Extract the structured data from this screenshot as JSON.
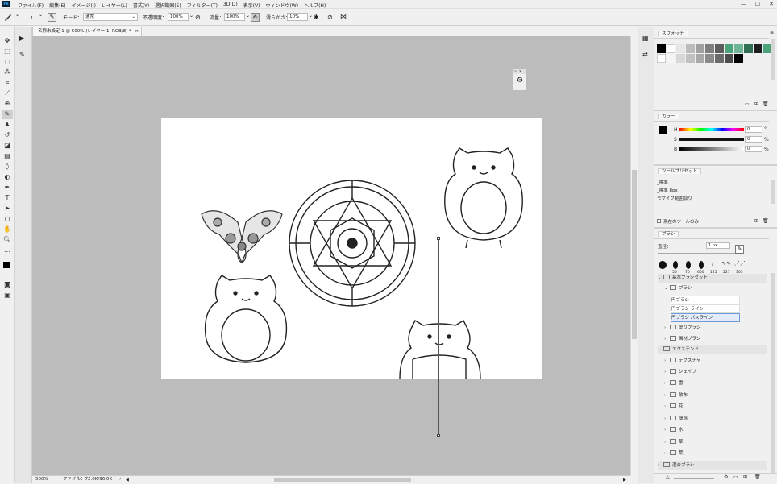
{
  "app": {
    "logo": "Ps"
  },
  "menu": [
    "ファイル(F)",
    "編集(E)",
    "イメージ(I)",
    "レイヤー(L)",
    "書式(Y)",
    "選択範囲(S)",
    "フィルター(T)",
    "3D(D)",
    "表示(V)",
    "ウィンドウ(W)",
    "ヘルプ(H)"
  ],
  "window_controls": {
    "minimize": "—",
    "maximize": "☐",
    "close": "✕"
  },
  "options": {
    "brush_size": "1",
    "mode_label": "モード：",
    "mode_value": "通常",
    "opacity_label": "不透明度：",
    "opacity_value": "100%",
    "flow_label": "流量：",
    "flow_value": "100%",
    "smoothing_label": "滑らかさ：",
    "smoothing_value": "10%"
  },
  "document": {
    "tab_title": "名称未設定 1 @ 500% (レイヤー 1, RGB/8) *",
    "tab_close": "×"
  },
  "status": {
    "zoom": "500%",
    "file_info": "ファイル：72.0K/96.0K"
  },
  "panels": {
    "swatches": {
      "tab": "スウォッチ"
    },
    "color": {
      "tab": "カラー",
      "h_label": "H",
      "s_label": "S",
      "b_label": "B",
      "h_value": "0",
      "s_value": "0",
      "b_value": "0",
      "unit_deg": "°",
      "unit_pct": "%"
    },
    "tool_presets": {
      "tab": "ツールプリセット",
      "items": [
        "_標準",
        "_標準 8px",
        "モザイク範囲取り"
      ],
      "current_tool_only": "現在のツールのみ"
    },
    "brushes": {
      "tab": "ブラシ",
      "size_label": "直径：",
      "size_value": "1 px",
      "recent_sizes": [
        "50",
        "70",
        "600",
        "125",
        "227",
        "303"
      ],
      "groups": [
        {
          "label": "基本ブラシセット",
          "level": 0,
          "open": true
        },
        {
          "label": "ブラシ",
          "level": 1,
          "open": true
        },
        {
          "label": "円ブラシ",
          "level": 2,
          "leaf": true
        },
        {
          "label": "円ブラシ ライン",
          "level": 2,
          "leaf": true
        },
        {
          "label": "円ブラシ パスライン",
          "level": 2,
          "leaf": true,
          "selected": true
        },
        {
          "label": "塗りブラシ",
          "level": 1
        },
        {
          "label": "画材ブラシ",
          "level": 1
        },
        {
          "label": "エクステンド",
          "level": 0,
          "open": true
        },
        {
          "label": "テクスチャ",
          "level": 1
        },
        {
          "label": "シェイプ",
          "level": 1
        },
        {
          "label": "雪",
          "level": 1
        },
        {
          "label": "飲布",
          "level": 1
        },
        {
          "label": "花",
          "level": 1
        },
        {
          "label": "簡感",
          "level": 1
        },
        {
          "label": "水",
          "level": 1
        },
        {
          "label": "草",
          "level": 1
        },
        {
          "label": "葉",
          "level": 1
        },
        {
          "label": "混合ブラシ",
          "level": 0
        }
      ]
    }
  },
  "colors": {
    "accent": "#31a8ff",
    "foreground": "#000000",
    "background": "#4aa37a"
  }
}
